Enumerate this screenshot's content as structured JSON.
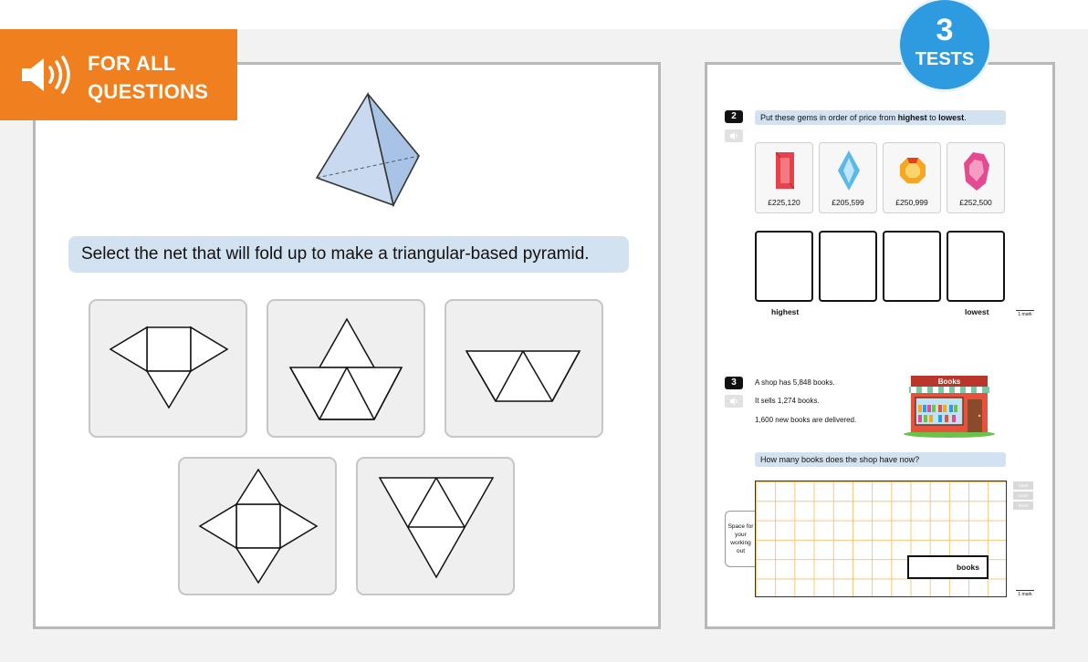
{
  "audio_banner": {
    "label_line1": "FOR ALL",
    "label_line2": "QUESTIONS"
  },
  "question_main": {
    "instruction": "Select the net that will fold up to make a triangular-based pyramid."
  },
  "tests_badge": {
    "number": "3",
    "label": "TESTS"
  },
  "q2": {
    "number": "2",
    "prompt_pre": "Put these gems in order of price from ",
    "prompt_bold1": "highest",
    "prompt_mid": " to ",
    "prompt_bold2": "lowest",
    "prompt_end": ".",
    "gems": [
      {
        "price": "£225,120",
        "color": "#e8414b"
      },
      {
        "price": "£205,599",
        "color": "#5ab8ea"
      },
      {
        "price": "£250,999",
        "color": "#f5a623"
      },
      {
        "price": "£252,500",
        "color": "#e44a8f"
      }
    ],
    "label_highest": "highest",
    "label_lowest": "lowest",
    "mark": "1 mark"
  },
  "q3": {
    "number": "3",
    "line1": "A shop has 5,848 books.",
    "line2": "It sells 1,274 books.",
    "line3": "1,600 new books are delivered.",
    "shop_sign": "Books",
    "prompt": "How many books does the shop have now?",
    "working_label": "Space for your working out",
    "answer_unit": "books",
    "tools": [
      "Clear",
      "Undo",
      "Redo"
    ],
    "mark": "1 mark"
  }
}
